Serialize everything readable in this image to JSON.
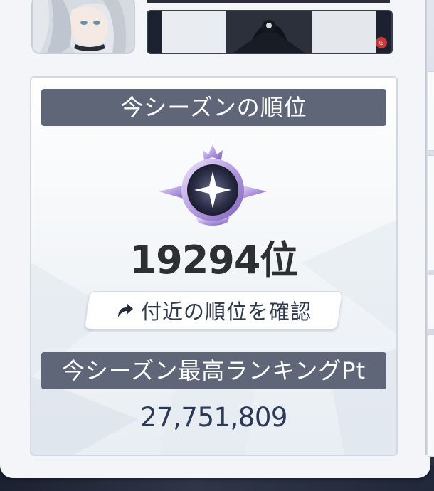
{
  "rank_card": {
    "title": "今シーズンの順位",
    "rank": "19294位",
    "nearby_button_label": "付近の順位を確認",
    "points_title": "今シーズン最高ランキングPt",
    "points_value": "27,751,809"
  },
  "icons": {
    "emblem": "tier-emblem-icon",
    "nearby_button": "redo-arrow-icon"
  },
  "colors": {
    "header_bar": "#5e6677",
    "rank_text": "#2d2f33",
    "points_text": "#2c3a58",
    "emblem_accent": "#b59be0"
  }
}
